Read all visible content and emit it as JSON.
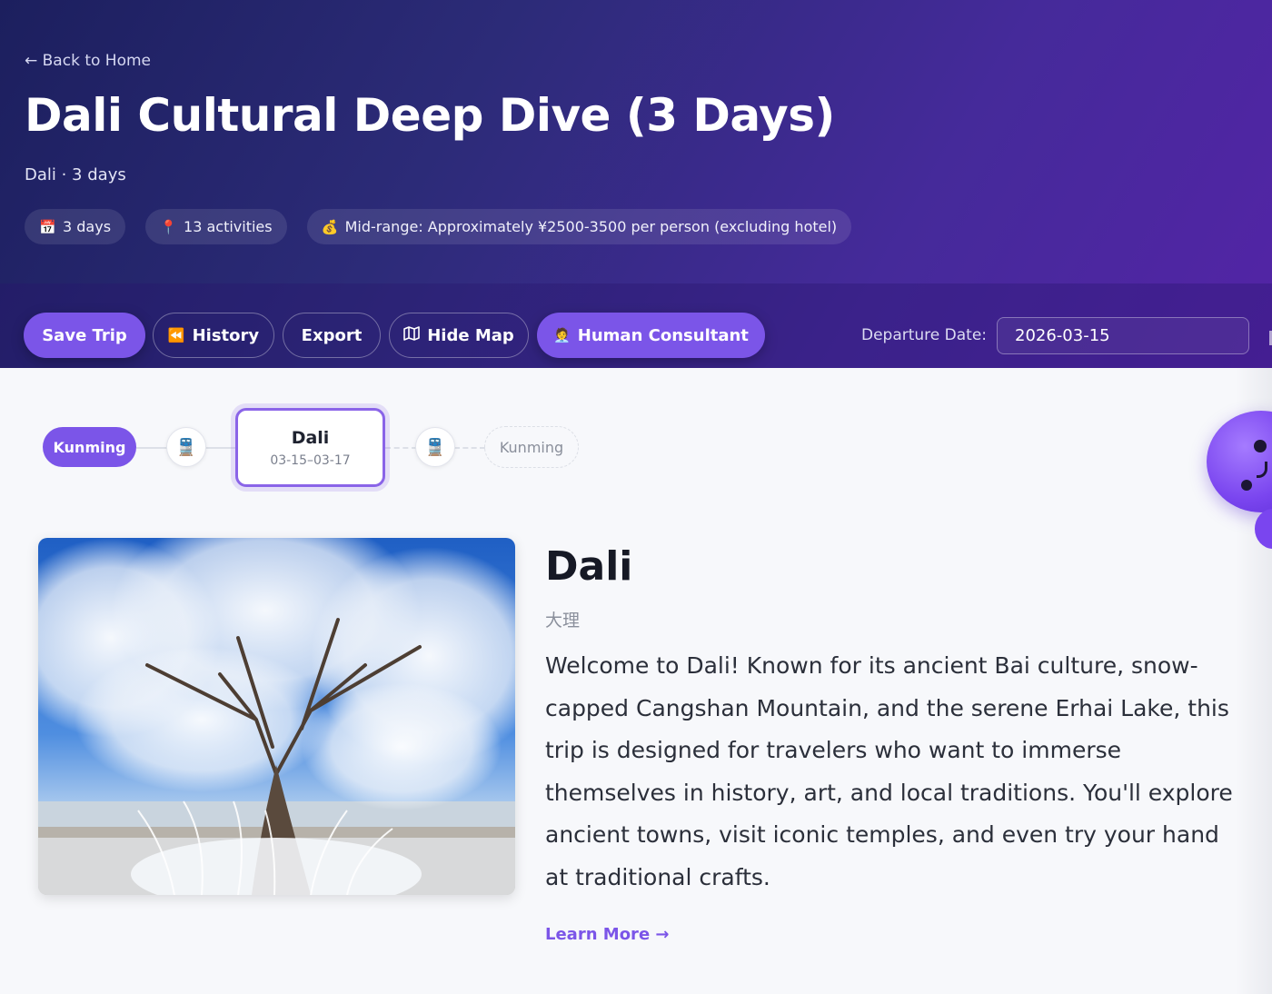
{
  "header": {
    "back_link": "← Back to Home",
    "title": "Dali Cultural Deep Dive (3 Days)",
    "subtitle": "Dali · 3 days",
    "chips": [
      {
        "icon": "calendar-icon",
        "glyph": "📅",
        "label": "3 days"
      },
      {
        "icon": "pin-icon",
        "glyph": "📍",
        "label": "13 activities"
      },
      {
        "icon": "money-bag-icon",
        "glyph": "💰",
        "label": "Mid-range: Approximately ¥2500-3500 per person (excluding hotel)"
      }
    ]
  },
  "toolbar": {
    "save_trip": "Save Trip",
    "history": "History",
    "export": "Export",
    "hide_map": "Hide Map",
    "human_consultant": "Human Consultant",
    "departure_label": "Departure Date:",
    "departure_value": "2026-03-15"
  },
  "route": {
    "start": "Kunming",
    "current": {
      "name": "Dali",
      "dates": "03-15–03-17"
    },
    "end": "Kunming",
    "transit_icon": "train-icon"
  },
  "destination": {
    "name": "Dali",
    "native_name": "大理",
    "description": "Welcome to Dali! Known for its ancient Bai culture, snow-capped Cangshan Mountain, and the serene Erhai Lake, this trip is designed for travelers who want to immerse themselves in history, art, and local traditions. You'll explore ancient towns, visit iconic temples, and even try your hand at traditional crafts.",
    "learn_more": "Learn More →"
  },
  "colors": {
    "accent": "#7b55e8",
    "header_start": "#1c1f5e",
    "header_end": "#5324a6"
  }
}
